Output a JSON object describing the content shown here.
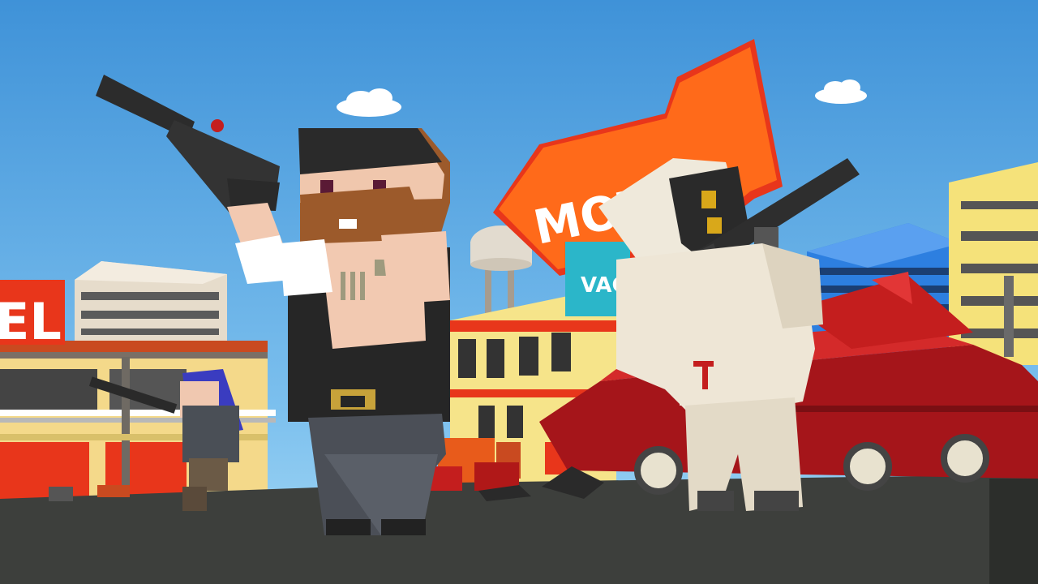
{
  "scene": {
    "title": "",
    "signs": {
      "motel_main": "MOTEL",
      "vacancy": "VAC",
      "motel_left_fragment": "EL"
    },
    "shirt_emblem": "T"
  },
  "colors": {
    "sky_top": "#3f92d8",
    "sky_bottom": "#8fcdf2",
    "ground": "#3d3f3c",
    "sign_orange": "#ff6a1a",
    "sign_red": "#e8361b",
    "vacancy_teal": "#2bb6c9",
    "tank_red": "#c41e1e",
    "building_yellow": "#f5e27a",
    "building_blue": "#2d7fe0"
  },
  "characters": [
    {
      "name": "bearded-gunman-icon",
      "desc_icon": "pistol-icon"
    },
    {
      "name": "hazmat-soldier-icon",
      "desc_icon": "rifle-icon"
    },
    {
      "name": "blue-haired-girl-icon",
      "desc_icon": "rifle-icon"
    }
  ]
}
